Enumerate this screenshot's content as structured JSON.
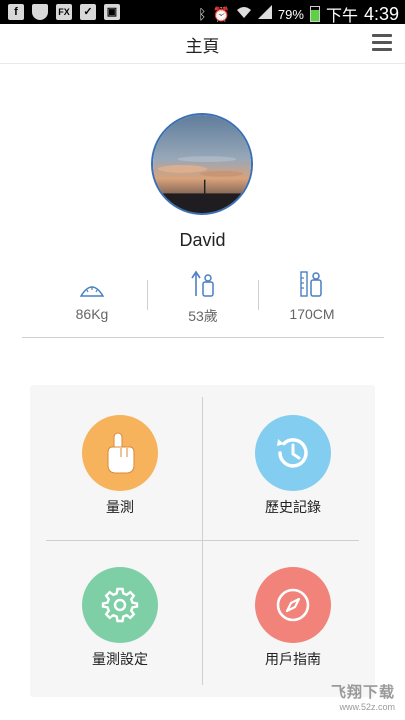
{
  "status_bar": {
    "battery_percent": "79%",
    "battery_level": 0.79,
    "period": "下午",
    "time": "4:39",
    "left_icons": [
      "facebook-icon",
      "shield-icon",
      "fx-icon",
      "checklist-icon",
      "briefcase-icon"
    ],
    "right_icons": [
      "bluetooth-icon",
      "alarm-icon",
      "wifi-icon",
      "signal-icon",
      "battery-icon"
    ]
  },
  "header": {
    "title": "主頁",
    "menu_icon": "hamburger-menu-icon"
  },
  "profile": {
    "name": "David",
    "stats": [
      {
        "icon": "scale-icon",
        "value": "86Kg"
      },
      {
        "icon": "age-icon",
        "value": "53歲"
      },
      {
        "icon": "height-icon",
        "value": "170CM"
      }
    ]
  },
  "menu": [
    {
      "label": "量測",
      "icon": "hand-pointer-icon",
      "color": "#f7b35b"
    },
    {
      "label": "歷史記錄",
      "icon": "history-icon",
      "color": "#82cdf0"
    },
    {
      "label": "量測設定",
      "icon": "gear-icon",
      "color": "#7fcfa6"
    },
    {
      "label": "用戶指南",
      "icon": "compass-icon",
      "color": "#f2837a"
    }
  ],
  "watermark": {
    "line1": "飞翔下载",
    "line2": "www.52z.com"
  },
  "colors": {
    "accent_blue": "#3b6fb4",
    "icon_blue": "#4a7fc1"
  }
}
